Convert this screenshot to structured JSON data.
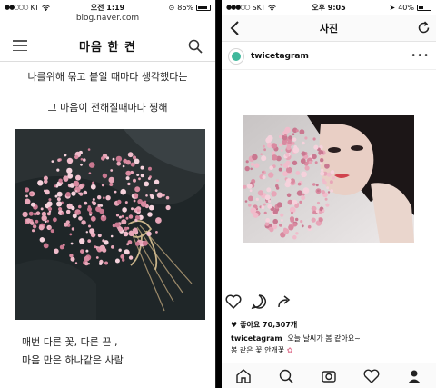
{
  "left": {
    "status": {
      "carrier": "KT",
      "time": "오전 1:19",
      "battery": "86%",
      "battery_level": 0.86
    },
    "url": "blog.naver.com",
    "blog_title": "마음 한 켠",
    "lyrics": [
      "나를위해 묶고 붙일 때마다 생각했다는",
      "그 마음이 전해질때마다 찡해"
    ],
    "captions": [
      "매번 다른 꽃, 다른 끈 ,",
      "마음 만은 하나같은   사람"
    ],
    "icons": {
      "menu": "hamburger-menu-icon",
      "search": "search-icon"
    }
  },
  "right": {
    "status": {
      "carrier": "SKT",
      "time": "오후 9:05",
      "battery": "40%",
      "battery_level": 0.4
    },
    "nav_title": "사진",
    "username": "twicetagram",
    "likes": "좋아요 70,307개",
    "caption_user": "twicetagram",
    "caption_text": "오늘 날씨가 봄 같아요~!",
    "caption_line2": "봄 같은 꽃 안개꽃",
    "icons": [
      "heart-icon",
      "comment-icon",
      "share-icon"
    ],
    "tabs": [
      "home-icon",
      "search-icon",
      "camera-icon",
      "activity-heart-icon",
      "profile-icon"
    ]
  },
  "colors": {
    "avatar_ring": "#3fb89c",
    "flower_pink": "#e7a6b8",
    "ig_bar": "#fafafa"
  }
}
